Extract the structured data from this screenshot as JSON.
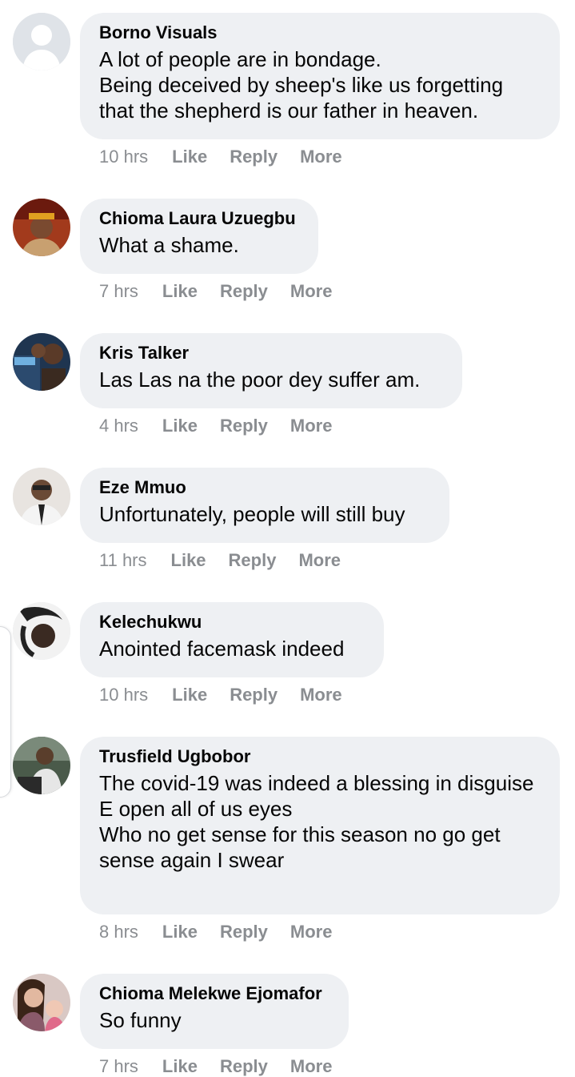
{
  "comments": [
    {
      "author": "Borno Visuals",
      "text": "A lot of people are in bondage.\nBeing deceived by sheep's like us forgetting that the shepherd is our father in heaven.",
      "time": "10 hrs",
      "like": "Like",
      "reply": "Reply",
      "more": "More",
      "avatar": "default-profile-icon"
    },
    {
      "author": "Chioma Laura Uzuegbu",
      "text": "What a shame.",
      "time": "7 hrs",
      "like": "Like",
      "reply": "Reply",
      "more": "More",
      "avatar": "profile-photo"
    },
    {
      "author": "Kris Talker",
      "text": "Las Las na the poor dey suffer am.",
      "time": "4 hrs",
      "like": "Like",
      "reply": "Reply",
      "more": "More",
      "avatar": "profile-photo"
    },
    {
      "author": "Eze Mmuo",
      "text": "Unfortunately, people will still buy",
      "time": "11 hrs",
      "like": "Like",
      "reply": "Reply",
      "more": "More",
      "avatar": "profile-photo"
    },
    {
      "author": "Kelechukwu",
      "text": "Anointed facemask indeed",
      "time": "10 hrs",
      "like": "Like",
      "reply": "Reply",
      "more": "More",
      "avatar": "profile-photo"
    },
    {
      "author": "Trusfield Ugbobor",
      "text": "The covid-19 was indeed a blessing in disguise\nE open all of us eyes\nWho no get sense for this season no go get sense again I swear",
      "time": "8 hrs",
      "like": "Like",
      "reply": "Reply",
      "more": "More",
      "avatar": "profile-photo"
    },
    {
      "author": "Chioma Melekwe Ejomafor",
      "text": "So funny",
      "time": "7 hrs",
      "like": "Like",
      "reply": "Reply",
      "more": "More",
      "avatar": "profile-photo"
    }
  ],
  "colors": {
    "bubble": "#eef0f3",
    "meta": "#8a8d91",
    "text": "#050505"
  }
}
